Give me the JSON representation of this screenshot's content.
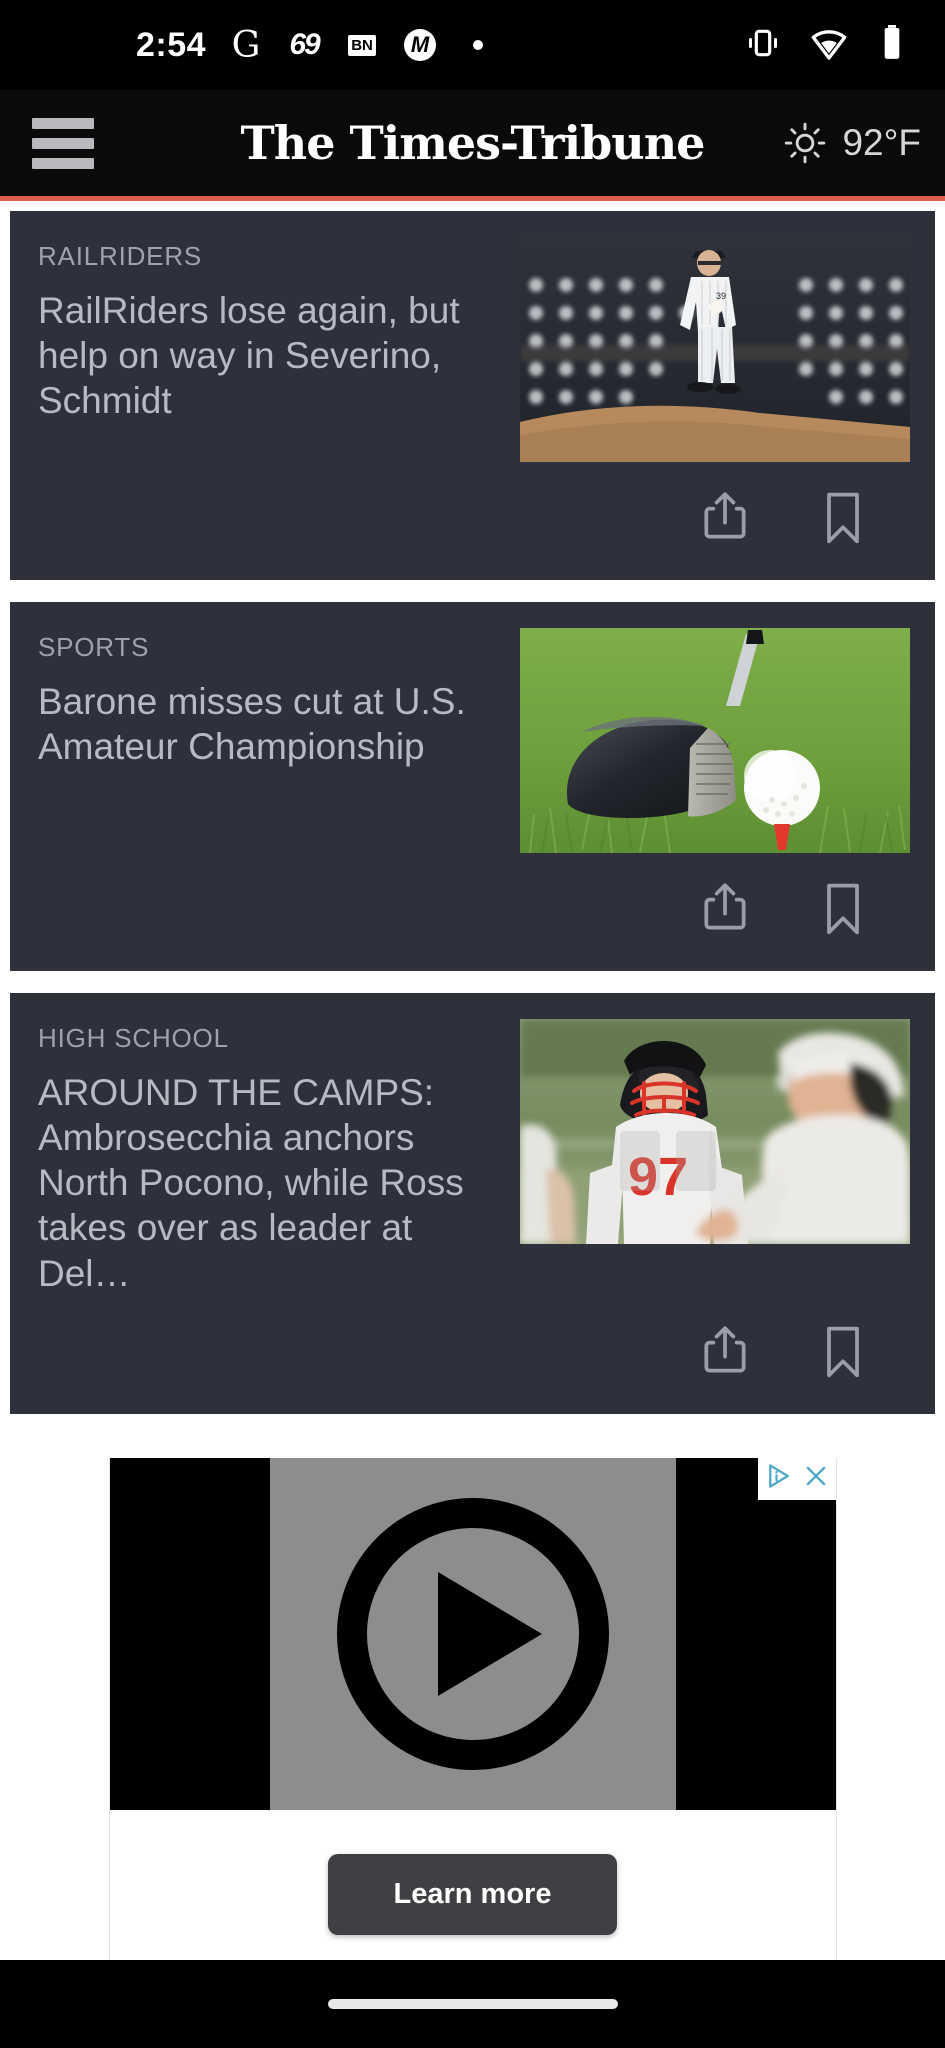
{
  "status_bar": {
    "time": "2:54",
    "icons": [
      "google-icon",
      "sixtynine-app-icon",
      "bn-app-icon",
      "m-app-icon",
      "dot-icon"
    ],
    "right_icons": [
      "vibrate-icon",
      "wifi-icon",
      "battery-icon"
    ],
    "bn_label": "BN",
    "g_label": "G",
    "sixtynine_label": "69",
    "m_label": "M"
  },
  "header": {
    "menu_label": "menu",
    "masthead": "The Times-Tribune",
    "weather_temp": "92°F",
    "weather_icon": "sun-icon",
    "accent_color": "#d9604a"
  },
  "feed": {
    "cards": [
      {
        "kicker": "RAILRIDERS",
        "headline": "RailRiders lose again, but help on way in Severino, Schmidt",
        "image_alt": "baseball-pitcher-photo",
        "share_label": "Share",
        "bookmark_label": "Bookmark"
      },
      {
        "kicker": "SPORTS",
        "headline": "Barone misses cut at U.S. Amateur Championship",
        "image_alt": "golf-club-and-ball-photo",
        "share_label": "Share",
        "bookmark_label": "Bookmark"
      },
      {
        "kicker": "HIGH SCHOOL",
        "headline": "AROUND THE CAMPS: Ambrosecchia anchors North Pocono, while Ross takes over as leader at Del…",
        "image_alt": "high-school-football-practice-photo",
        "share_label": "Share",
        "bookmark_label": "Bookmark"
      }
    ]
  },
  "advertisement": {
    "adchoices_icon": "adchoices-icon",
    "close_icon": "close-icon",
    "play_icon": "play-icon",
    "cta_label": "Learn more",
    "accent_color": "#4fa8c5"
  },
  "navigation_bar": {
    "gesture_pill": "home-gesture-pill"
  }
}
